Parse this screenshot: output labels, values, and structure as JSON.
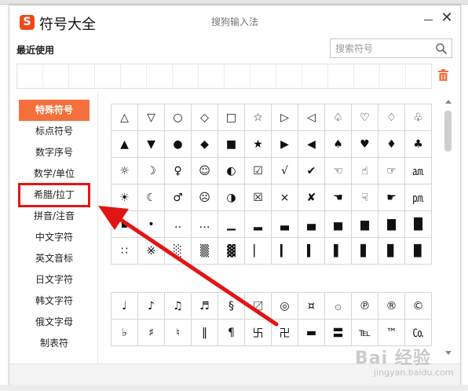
{
  "window": {
    "app_title": "符号大全",
    "subtitle": "搜狗输入法",
    "logo_letter": "S",
    "close_glyph": "✕"
  },
  "recent": {
    "label": "最近使用"
  },
  "search": {
    "placeholder": "搜索符号"
  },
  "sidebar": {
    "items": [
      {
        "label": "特殊符号",
        "state": "selected"
      },
      {
        "label": "标点符号"
      },
      {
        "label": "数字序号"
      },
      {
        "label": "数学/单位"
      },
      {
        "label": "希腊/拉丁",
        "state": "highlighted"
      },
      {
        "label": "拼音/注音"
      },
      {
        "label": "中文字符"
      },
      {
        "label": "英文音标"
      },
      {
        "label": "日文字符"
      },
      {
        "label": "韩文字符"
      },
      {
        "label": "俄文字母"
      },
      {
        "label": "制表符"
      }
    ]
  },
  "symbol_grid_1": [
    [
      "△",
      "▽",
      "○",
      "◇",
      "□",
      "☆",
      "▷",
      "◁",
      "♤",
      "♡",
      "♢",
      "♧"
    ],
    [
      "▲",
      "▼",
      "●",
      "◆",
      "■",
      "★",
      "▶",
      "◀",
      "♠",
      "♥",
      "♦",
      "♣"
    ],
    [
      "☼",
      "☽",
      "♀",
      "☺",
      "◐",
      "☑",
      "√",
      "✔",
      "☜",
      "☝",
      "☞",
      "㏂"
    ],
    [
      "☀",
      "☾",
      "♂",
      "☹",
      "◑",
      "☒",
      "×",
      "✘",
      "☚",
      "☟",
      "☛",
      "㏘"
    ],
    [
      "▪",
      "•",
      "‥",
      "…",
      "▁",
      "▂",
      "▃",
      "▄",
      "▅",
      "▆",
      "▇",
      "█"
    ],
    [
      "∷",
      "※",
      "░",
      "▒",
      "▓",
      "▏",
      "▎",
      "▍",
      "▌",
      "▋",
      "▊",
      "▉"
    ]
  ],
  "symbol_grid_2": [
    [
      "♩",
      "♪",
      "♫",
      "♬",
      "§",
      "〼",
      "◎",
      "¤",
      "۞",
      "℗",
      "®",
      "©"
    ],
    [
      "♭",
      "♯",
      "♮",
      "‖",
      "¶",
      "卐",
      "卍",
      "▬",
      "〓",
      "℡",
      "™",
      "㏇"
    ]
  ],
  "watermark": {
    "text": "Bai 经验",
    "sub": "jingyan.baidu.com"
  },
  "colors": {
    "accent": "#f5703c",
    "highlight_box": "#e21515",
    "arrow": "#e21515",
    "logo": "#f04a1a"
  }
}
